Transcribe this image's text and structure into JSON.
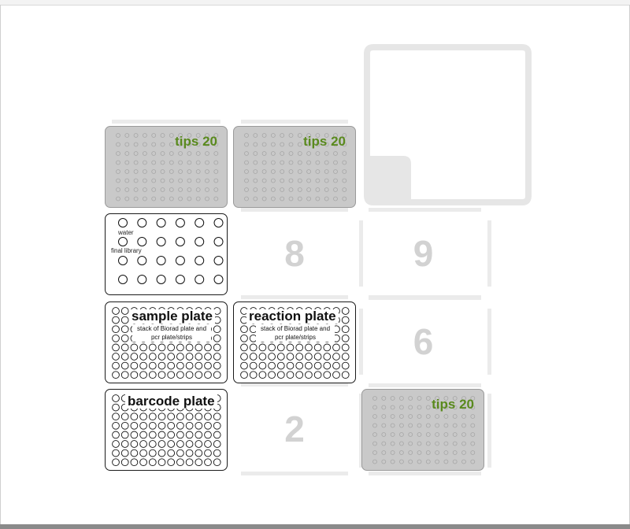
{
  "colors": {
    "tip_label": "#5a8a1e",
    "tiprack_fill": "#c9c9c9",
    "slot_number": "#d2d2d2",
    "slot_edge": "#ebebeb"
  },
  "slots": {
    "empty": [
      {
        "id": "slot-8",
        "number": "8"
      },
      {
        "id": "slot-9",
        "number": "9"
      },
      {
        "id": "slot-6",
        "number": "6"
      },
      {
        "id": "slot-2",
        "number": "2"
      }
    ]
  },
  "labware": {
    "tips_10": {
      "label": "tips 20"
    },
    "tips_11": {
      "label": "tips 20"
    },
    "tips_3": {
      "label": "tips 20"
    },
    "reservoir_7": {
      "well_labels": [
        "water",
        "final library"
      ]
    },
    "sample_plate": {
      "title": "sample plate",
      "subtitle": "stack of Biorad plate and pcr plate/strips"
    },
    "reaction_plate": {
      "title": "reaction plate",
      "subtitle": "stack of Biorad plate and pcr plate/strips"
    },
    "barcode_plate": {
      "title": "barcode plate"
    }
  }
}
